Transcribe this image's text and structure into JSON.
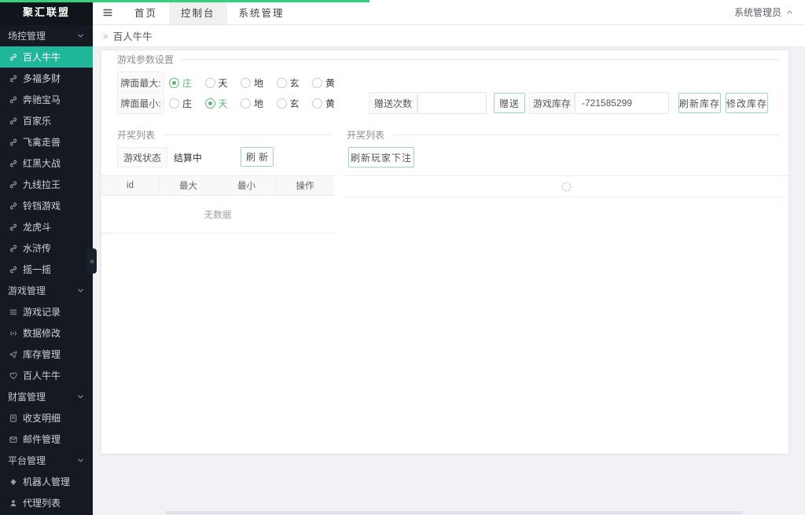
{
  "app": {
    "logo": "聚汇联盟",
    "user": "系统管理员"
  },
  "colors": {
    "accent": "#1fb699",
    "progress": "#35d07e",
    "button_border": "#9ed5ca",
    "radio_selected": "#5fb878"
  },
  "topnav": {
    "tabs": [
      {
        "label": "首页",
        "active": false
      },
      {
        "label": "控制台",
        "active": true
      },
      {
        "label": "系统管理",
        "active": false
      }
    ]
  },
  "breadcrumb": {
    "prefix": "»",
    "current": "百人牛牛"
  },
  "sidebar": {
    "collapse_glyph": "«",
    "items": [
      {
        "label": "场控管理",
        "type": "section",
        "icon": "chevron-down-icon"
      },
      {
        "label": "百人牛牛",
        "type": "item",
        "icon": "link-icon",
        "active": true
      },
      {
        "label": "多福多财",
        "type": "item",
        "icon": "link-icon"
      },
      {
        "label": "奔驰宝马",
        "type": "item",
        "icon": "link-icon"
      },
      {
        "label": "百家乐",
        "type": "item",
        "icon": "link-icon"
      },
      {
        "label": "飞禽走兽",
        "type": "item",
        "icon": "link-icon"
      },
      {
        "label": "红黑大战",
        "type": "item",
        "icon": "link-icon"
      },
      {
        "label": "九线拉王",
        "type": "item",
        "icon": "link-icon"
      },
      {
        "label": "铃铛游戏",
        "type": "item",
        "icon": "link-icon"
      },
      {
        "label": "龙虎斗",
        "type": "item",
        "icon": "link-icon"
      },
      {
        "label": "水浒传",
        "type": "item",
        "icon": "link-icon"
      },
      {
        "label": "摇一摇",
        "type": "item",
        "icon": "link-icon"
      },
      {
        "label": "游戏管理",
        "type": "section",
        "icon": "chevron-down-icon"
      },
      {
        "label": "游戏记录",
        "type": "item",
        "icon": "list-icon"
      },
      {
        "label": "数据修改",
        "type": "item",
        "icon": "broadcast-icon"
      },
      {
        "label": "库存管理",
        "type": "item",
        "icon": "send-icon"
      },
      {
        "label": "百人牛牛",
        "type": "item",
        "icon": "heart-icon"
      },
      {
        "label": "财富管理",
        "type": "section",
        "icon": "chevron-down-icon"
      },
      {
        "label": "收支明细",
        "type": "item",
        "icon": "ledger-icon"
      },
      {
        "label": "邮件管理",
        "type": "item",
        "icon": "mail-icon"
      },
      {
        "label": "平台管理",
        "type": "section",
        "icon": "chevron-down-icon"
      },
      {
        "label": "机器人管理",
        "type": "item",
        "icon": "robot-icon"
      },
      {
        "label": "代理列表",
        "type": "item",
        "icon": "user-icon"
      }
    ]
  },
  "panels": {
    "params": {
      "title": "游戏参数设置",
      "rows": [
        {
          "label": "牌面最大:",
          "options": [
            "庄",
            "天",
            "地",
            "玄",
            "黄"
          ],
          "selected_index": 0,
          "selected_label": "庄"
        },
        {
          "label": "牌面最小:",
          "options": [
            "庄",
            "天",
            "地",
            "玄",
            "黄"
          ],
          "selected_index": 1,
          "selected_label": "天"
        }
      ],
      "gift": {
        "label": "赠送次数",
        "value": "",
        "button": "赠送"
      },
      "stock": {
        "label": "游戏库存",
        "value": "-721585299",
        "refresh_button": "刷新库存",
        "modify_button": "修改库存"
      }
    },
    "lottery_left": {
      "title": "开奖列表",
      "status_label": "游戏状态",
      "status_value": "结算中",
      "refresh_button": "刷新",
      "table": {
        "headers": [
          "id",
          "最大",
          "最小",
          "操作"
        ],
        "empty_text": "无数据",
        "rows": []
      }
    },
    "lottery_right": {
      "title": "开奖列表",
      "refresh_button": "刷新玩家下注",
      "loading": true
    }
  }
}
